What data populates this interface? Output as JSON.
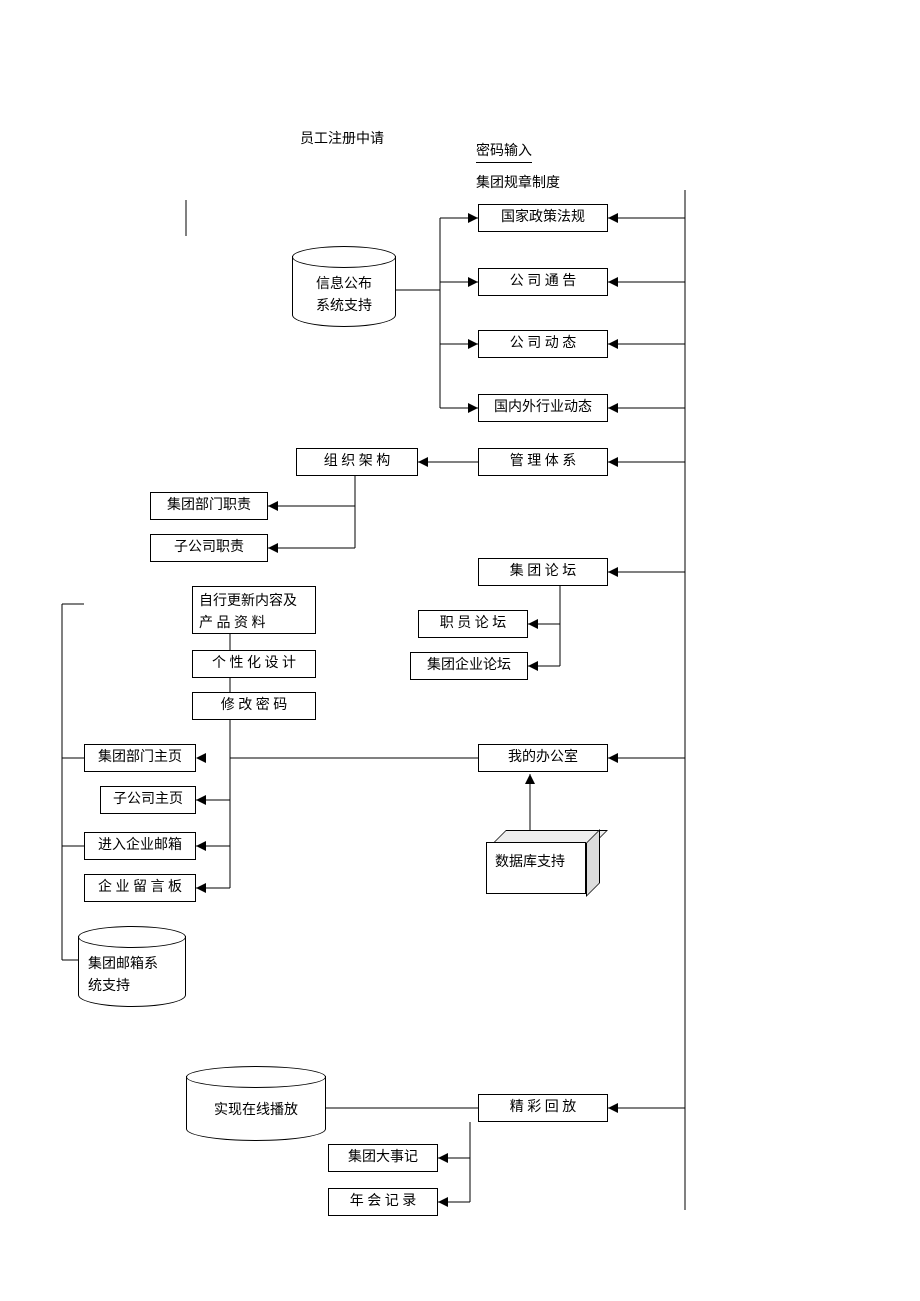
{
  "labels": {
    "reg": "员工注册中请",
    "pwd": "密码输入",
    "rules": "集团规章制度",
    "policy": "国家政策法规",
    "notice": "公 司 通 告",
    "news": "公 司 动 态",
    "industry": "国内外行业动态",
    "infoPub1": "信息公布",
    "infoPub2": "系统支持",
    "org": "组 织 架 构",
    "mgmt": "管 理 体 系",
    "deptDuty": "集团部门职责",
    "subDuty": "子公司职责",
    "forum": "集 团 论 坛",
    "staffForum": "职 员 论 坛",
    "entForum": "集团企业论坛",
    "selfUpdate1": "自行更新内容及",
    "selfUpdate2": "产 品 资 料",
    "personal": "个 性 化 设 计",
    "changePwd": "修 改 密 码",
    "deptHome": "集团部门主页",
    "subHome": "子公司主页",
    "myOffice": "我的办公室",
    "mail": "进入企业邮箱",
    "board": "企 业 留 言 板",
    "dbSupport": "数据库支持",
    "mailSys1": "集团邮箱系",
    "mailSys2": "统支持",
    "online": "实现在线播放",
    "replay": "精 彩 回 放",
    "events": "集团大事记",
    "annual": "年 会 记 录"
  }
}
